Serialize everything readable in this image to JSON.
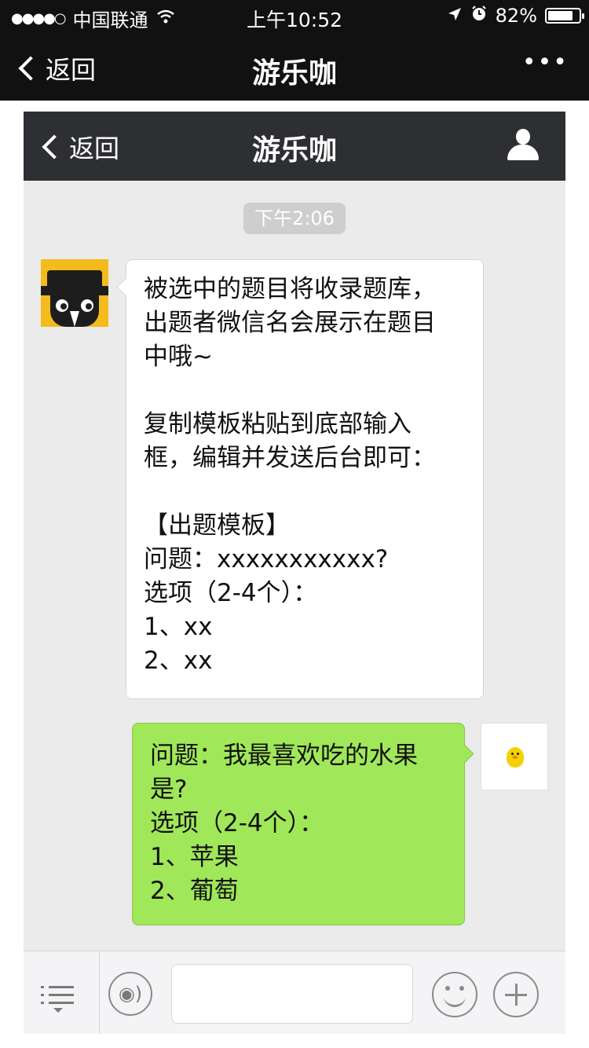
{
  "status_bar": {
    "signal_dots": "●●●●○",
    "carrier": "中国联通",
    "time": "上午10:52",
    "battery_percent": "82%",
    "battery_level": 0.82
  },
  "outer_nav": {
    "back_label": "返回",
    "title": "游乐咖",
    "more_label": "•••"
  },
  "chat": {
    "nav": {
      "back_label": "返回",
      "title": "游乐咖"
    },
    "timestamp": "下午2:06",
    "incoming_message": "被选中的题目将收录题库，\n出题者微信名会展示在题目\n中哦~\n\n复制模板粘贴到底部输入\n框，编辑并发送后台即可：\n\n【出题模板】\n问题：xxxxxxxxxxx?\n选项（2-4个）：\n1、xx\n2、xx",
    "outgoing_message": "问题：我最喜欢吃的水果\n是?\n选项（2-4个）：\n1、苹果\n2、葡萄"
  },
  "input_bar": {
    "voice_icon": "◉)",
    "text_value": ""
  },
  "colors": {
    "outgoing_bubble": "#a0e75a",
    "chat_background": "#ebebeb",
    "nav_dark": "#2e2f33"
  }
}
